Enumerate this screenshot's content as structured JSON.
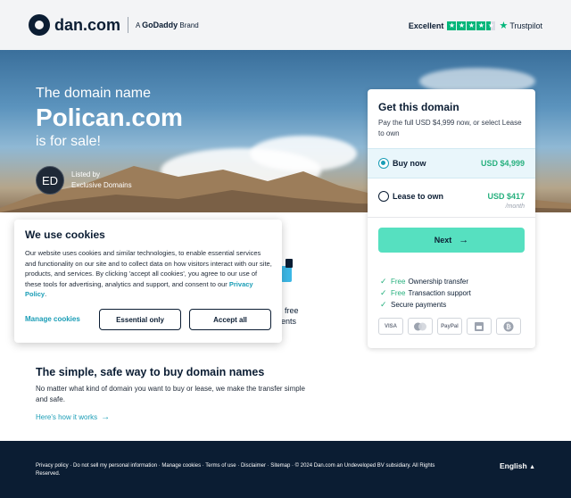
{
  "header": {
    "logo_text": "dan.com",
    "brand_prefix": "A",
    "brand_name": "GoDaddy",
    "brand_suffix": "Brand",
    "trust_label": "Excellent",
    "trust_brand": "Trustpilot",
    "trust_stars": 4.5
  },
  "hero": {
    "pre": "The domain name",
    "domain": "Polican.com",
    "post": "is for sale!",
    "avatar_initials": "ED",
    "seller_prefix": "Listed by",
    "seller_name": "Exclusive Domains"
  },
  "card": {
    "title": "Get this domain",
    "subtitle": "Pay the full USD $4,999 now, or select Lease to own",
    "buy_label": "Buy now",
    "buy_price": "USD $4,999",
    "lease_label": "Lease to own",
    "lease_price": "USD $417",
    "lease_period": "/month",
    "next_label": "Next",
    "features": [
      {
        "highlight": "Free",
        "text": "Ownership transfer"
      },
      {
        "highlight": "Free",
        "text": "Transaction support"
      },
      {
        "highlight": "",
        "text": "Secure payments"
      }
    ],
    "payments": [
      "VISA",
      "MC",
      "PayPal",
      "Bank",
      "BTC"
    ]
  },
  "behind": {
    "line1": "free",
    "line2": "ents"
  },
  "cookie": {
    "title": "We use cookies",
    "body": "Our website uses cookies and similar technologies, to enable essential services and functionality on our site and to collect data on how visitors interact with our site, products, and services. By clicking 'accept all cookies', you agree to our use of these tools for advertising, analytics and support, and consent to our ",
    "policy_link": "Privacy Policy",
    "body_end": ".",
    "manage": "Manage cookies",
    "essential": "Essential only",
    "accept": "Accept all"
  },
  "info": {
    "title": "The simple, safe way to buy domain names",
    "body": "No matter what kind of domain you want to buy or lease, we make the transfer simple and safe.",
    "link": "Here's how it works"
  },
  "footer": {
    "links": "Privacy policy · Do not sell my personal information · Manage cookies · Terms of use · Disclaimer · Sitemap · © 2024 Dan.com an Undeveloped BV subsidiary. All Rights Reserved.",
    "language": "English"
  },
  "colors": {
    "navy": "#0b1d33",
    "accent": "#1a9db6",
    "green": "#27b07e",
    "next_button": "#56e0c0",
    "trustpilot": "#00b67a"
  }
}
